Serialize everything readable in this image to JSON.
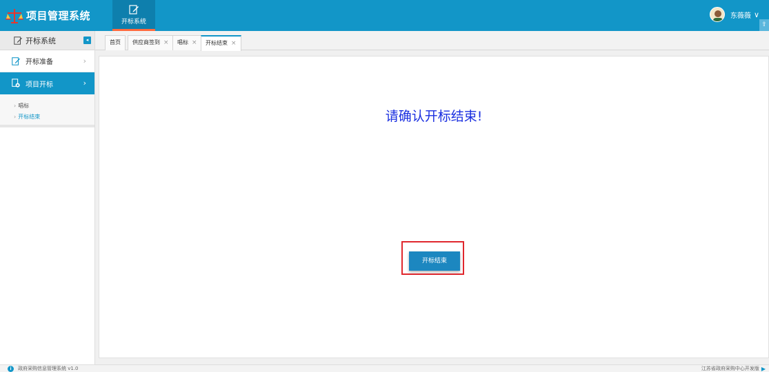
{
  "header": {
    "app_title": "项目管理系统",
    "module_tab_label": "开标系统",
    "user_name": "东薇薇",
    "user_chevron": "∨",
    "corner_icon": "⇧"
  },
  "sidebar": {
    "title": "开标系统",
    "collapse_icon": "◂",
    "items": [
      {
        "label": "开标准备",
        "icon": "edit-doc-icon",
        "arrow": "›",
        "active": false
      },
      {
        "label": "项目开标",
        "icon": "gavel-doc-icon",
        "arrow": "›",
        "active": true
      }
    ],
    "sub_items": [
      {
        "label": "唱标",
        "current": false
      },
      {
        "label": "开标结束",
        "current": true
      }
    ]
  },
  "tabs": [
    {
      "label": "首页",
      "closable": false
    },
    {
      "label": "供应商签到",
      "closable": true
    },
    {
      "label": "唱标",
      "closable": true
    },
    {
      "label": "开标结束",
      "closable": true,
      "active": true
    }
  ],
  "tab_close_glyph": "×",
  "main": {
    "confirm_message": "请确认开标结束!",
    "end_button_label": "开标结束"
  },
  "footer": {
    "left_text": "政府采购信息管理系统 v1.0",
    "right_text": "江苏省政府采购中心开发版",
    "info_glyph": "i",
    "right_glyph": "▶"
  },
  "colors": {
    "header_bg": "#1296c8",
    "accent_orange": "#ff6a3d",
    "confirm_text": "#1a2fe0",
    "highlight_border": "#e0262c"
  }
}
